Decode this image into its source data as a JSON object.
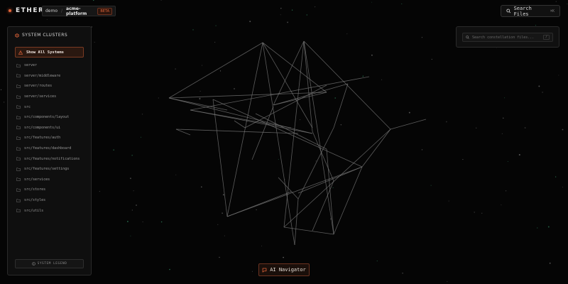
{
  "brand": {
    "name": "ETHER"
  },
  "breadcrumb": {
    "org": "demo",
    "separator": "/",
    "project": "acme-platform",
    "badge": "BETA"
  },
  "search": {
    "label": "Search Files",
    "shortcut": "⌘K"
  },
  "sidebar": {
    "title": "SYSTEM CLUSTERS",
    "show_all": "Show All Systems",
    "items": [
      {
        "label": "server"
      },
      {
        "label": "server/middleware"
      },
      {
        "label": "server/routes"
      },
      {
        "label": "server/services"
      },
      {
        "label": "src"
      },
      {
        "label": "src/components/layout"
      },
      {
        "label": "src/components/ui"
      },
      {
        "label": "src/features/auth"
      },
      {
        "label": "src/features/dashboard"
      },
      {
        "label": "src/features/notifications"
      },
      {
        "label": "src/features/settings"
      },
      {
        "label": "src/services"
      },
      {
        "label": "src/stores"
      },
      {
        "label": "src/styles"
      },
      {
        "label": "src/utils"
      }
    ],
    "legend_button": "SYSTEM LEGEND"
  },
  "filter": {
    "placeholder": "Search constellation files...",
    "shortcut": "/"
  },
  "ai_button": {
    "label": "AI Navigator"
  },
  "colors": {
    "accent": "#e0643a",
    "background": "#050505",
    "edge": "#7a7a7a"
  },
  "icons": {
    "brand": "dot-icon",
    "search": "search-icon",
    "cluster": "hexagon-icon",
    "show_all": "warning-icon",
    "folder": "folder-icon",
    "legend": "info-icon",
    "ai": "chat-icon"
  }
}
